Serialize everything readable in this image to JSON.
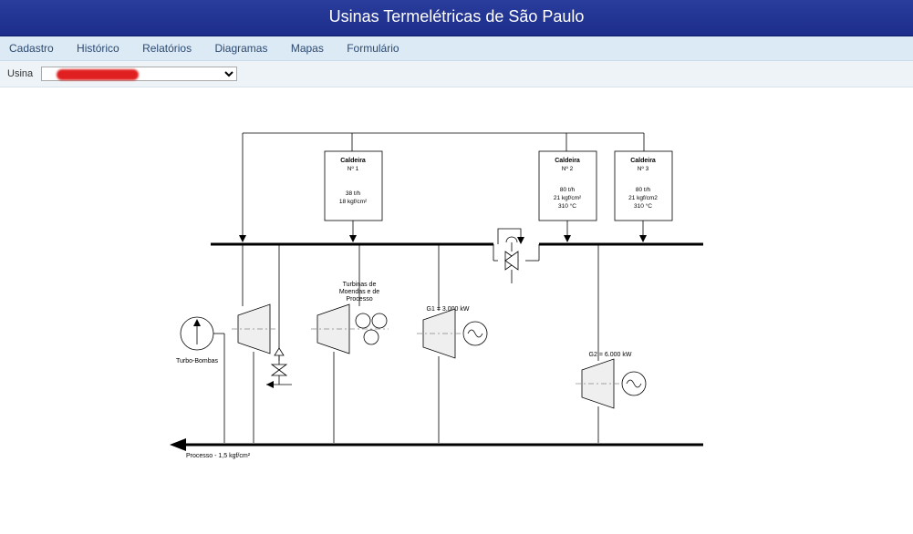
{
  "header": {
    "title": "Usinas Termelétricas de São Paulo"
  },
  "menu": {
    "items": [
      "Cadastro",
      "Histórico",
      "Relatórios",
      "Diagramas",
      "Mapas",
      "Formulário"
    ]
  },
  "filter": {
    "label": "Usina",
    "selected": "[redacted]"
  },
  "diagram": {
    "caldeira1": {
      "title": "Caldeira",
      "sub": "Nº 1",
      "l1": "38 t/h",
      "l2": "18 kgf/cm²"
    },
    "caldeira2": {
      "title": "Caldeira",
      "sub": "Nº 2",
      "l1": "80 t/h",
      "l2": "21 kgf/cm²",
      "l3": "310 °C"
    },
    "caldeira3": {
      "title": "Caldeira",
      "sub": "Nº 3",
      "l1": "80 t/h",
      "l2": "21 kgf/cm2",
      "l3": "310 °C"
    },
    "turbo_bombas": "Turbo-Bombas",
    "turbinas": {
      "l1": "Turbinas de",
      "l2": "Moendas e de",
      "l3": "Processo"
    },
    "g1": "G1 = 3.000 kW",
    "g2": "G2 = 6.000 kW",
    "processo": "Processo - 1,5 kgf/cm²"
  }
}
